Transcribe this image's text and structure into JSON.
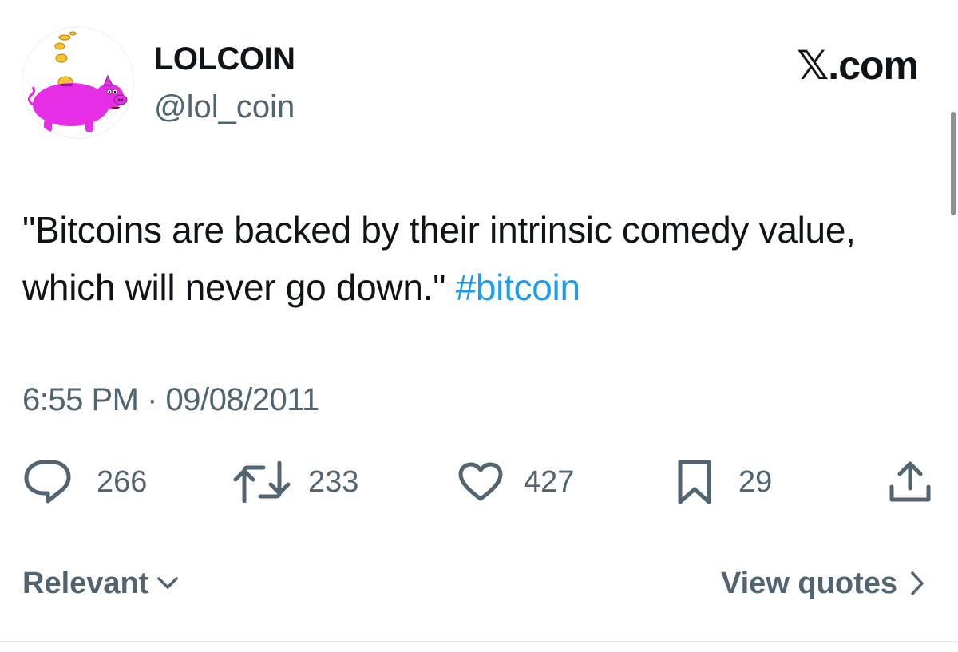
{
  "author": {
    "display_name": "LOLCOIN",
    "handle": "@lol_coin",
    "avatar_icon": "piggy-bank-with-coins"
  },
  "site": {
    "label": "𝕏.com"
  },
  "tweet": {
    "text": "\"Bitcoins are backed by their intrinsic comedy value, which will never go down.\" ",
    "hashtag": "#bitcoin",
    "timestamp": "6:55 PM · 09/08/2011"
  },
  "actions": {
    "reply": {
      "icon": "reply-icon",
      "count": "266"
    },
    "retweet": {
      "icon": "retweet-icon",
      "count": "233"
    },
    "like": {
      "icon": "heart-icon",
      "count": "427"
    },
    "bookmark": {
      "icon": "bookmark-icon",
      "count": "29"
    },
    "share": {
      "icon": "share-icon"
    }
  },
  "footer": {
    "sort_label": "Relevant",
    "quotes_label": "View quotes"
  },
  "colors": {
    "text": "#0f1419",
    "secondary": "#536471",
    "link": "#1d9bf0",
    "pig": "#e62ee6"
  }
}
